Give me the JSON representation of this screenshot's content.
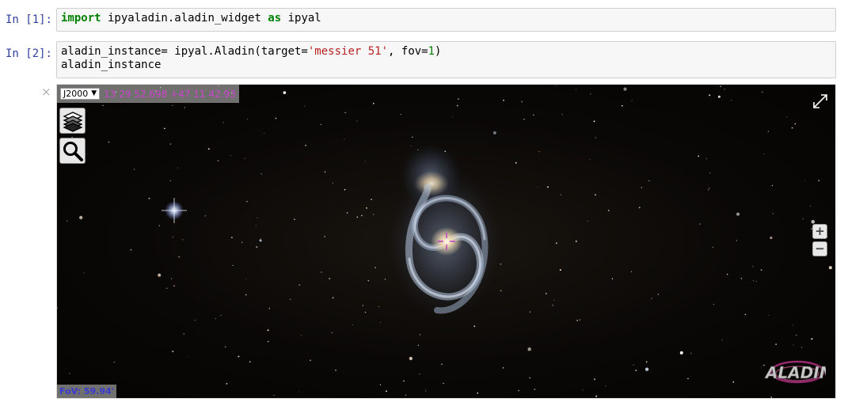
{
  "cells": [
    {
      "prompt": "In [1]:",
      "code": [
        [
          {
            "t": "import",
            "c": "kw"
          },
          {
            "t": " ipyaladin.aladin_widget ",
            "c": ""
          },
          {
            "t": "as",
            "c": "kw"
          },
          {
            "t": " ipyal",
            "c": ""
          }
        ]
      ]
    },
    {
      "prompt": "In [2]:",
      "code": [
        [
          {
            "t": "aladin_instance= ipyal.Aladin(target=",
            "c": ""
          },
          {
            "t": "'messier 51'",
            "c": "str"
          },
          {
            "t": ", fov=",
            "c": ""
          },
          {
            "t": "1",
            "c": "num"
          },
          {
            "t": ")",
            "c": ""
          }
        ],
        [
          {
            "t": "aladin_instance",
            "c": ""
          }
        ]
      ]
    }
  ],
  "output_close": "×",
  "aladin": {
    "frame": "J2000",
    "frame_arrow": "▼",
    "coordinates": "13 29 52.698 +47 11 42.93",
    "fov": "FoV: 59.94'",
    "zoom_in": "+",
    "zoom_out": "−",
    "logo_text": "ALADIN",
    "colors": {
      "coords": "#cc44cc",
      "fov": "#3a3ad0",
      "reticle": "#c040c0"
    },
    "icons": [
      "layers-icon",
      "search-icon",
      "fullscreen-icon",
      "aladin-logo"
    ]
  }
}
